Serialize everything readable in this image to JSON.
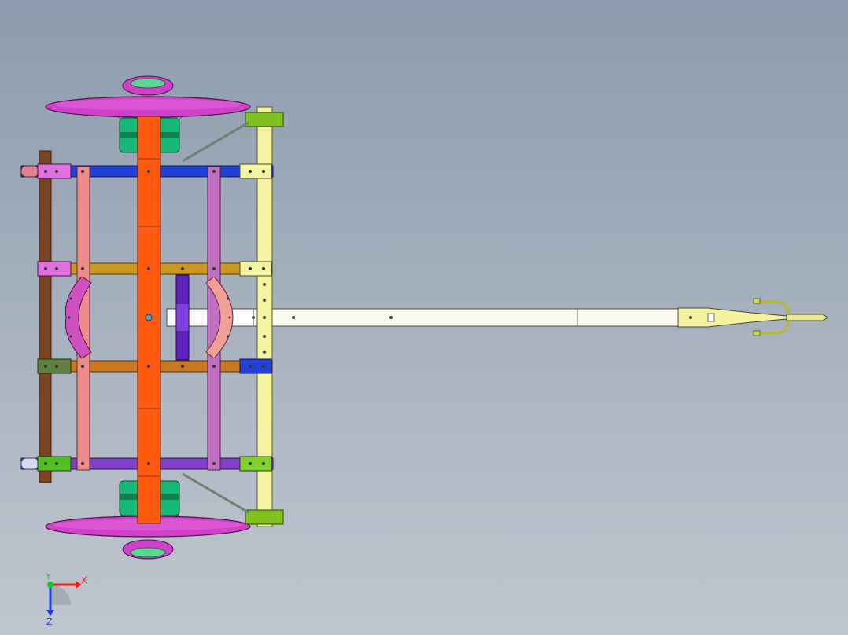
{
  "triad": {
    "x_label": "X",
    "y_label": "Y",
    "z_label": "Z",
    "x_color": "#e62020",
    "y_color": "#20c020",
    "z_color": "#2040e0"
  },
  "palette": {
    "background_top": "#8c9bad",
    "background_bottom": "#c0c6cf",
    "wheel": "#d040c8",
    "hub_band": "#18b878",
    "axle_beam": "#ff5a10",
    "front_crossbar": "#f4f4a0",
    "rear_rail": "#7a4420",
    "drawbar": "#fafaf0",
    "blue_crossbar": "#2040d8",
    "violet_crossbar": "#8040c8",
    "gold_crossbar": "#c89820",
    "tan_crossbar": "#c87820",
    "pink_bar": "#f08c88",
    "lilac_bar": "#c070c0",
    "green_bracket": "#80c020",
    "hitch": "#d8d850"
  }
}
